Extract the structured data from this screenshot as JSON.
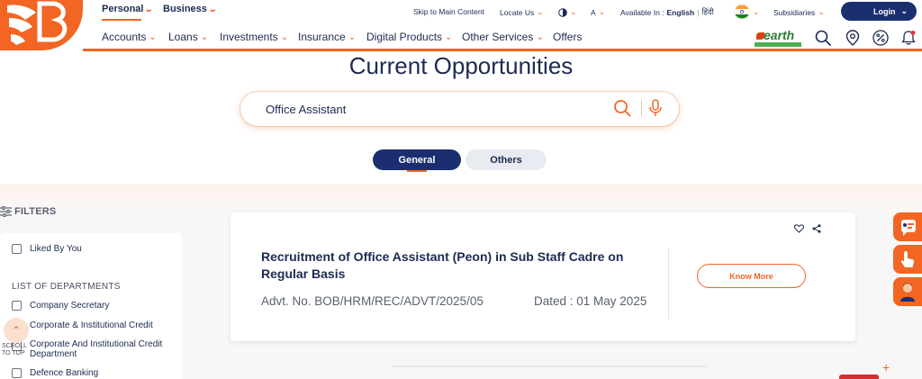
{
  "header": {
    "tabs": [
      {
        "label": "Personal",
        "active": true
      },
      {
        "label": "Business",
        "active": false
      }
    ],
    "top_links": {
      "skip": "Skip to Main Content",
      "locate": "Locate Us",
      "font_size": "A",
      "available_in_label": "Available In :",
      "lang_english": "English",
      "lang_hindi": "हिंदी",
      "subsidiaries": "Subsidiaries",
      "login": "Login"
    },
    "nav": [
      {
        "label": "Accounts",
        "has_menu": true
      },
      {
        "label": "Loans",
        "has_menu": true
      },
      {
        "label": "Investments",
        "has_menu": true
      },
      {
        "label": "Insurance",
        "has_menu": true
      },
      {
        "label": "Digital Products",
        "has_menu": true
      },
      {
        "label": "Other Services",
        "has_menu": true
      },
      {
        "label": "Offers",
        "has_menu": false
      }
    ],
    "earth_logo_text": "earth",
    "icons": [
      "search-icon",
      "location-pin-icon",
      "percent-icon",
      "notification-bell-icon"
    ]
  },
  "main": {
    "title": "Current Opportunities",
    "search": {
      "value": "Office Assistant",
      "placeholder": ""
    },
    "tabs": [
      {
        "label": "General",
        "active": true
      },
      {
        "label": "Others",
        "active": false
      }
    ]
  },
  "filters": {
    "heading": "FILTERS",
    "liked": "Liked By You",
    "departments_heading": "LIST OF DEPARTMENTS",
    "departments": [
      "Company Secretary",
      "Corporate & Institutional Credit",
      "Corporate And Institutional Credit Department",
      "Defence Banking"
    ],
    "scroll_to_top": "SCROLL TO TOP"
  },
  "job": {
    "title": "Recruitment of Office Assistant (Peon) in Sub Staff Cadre on Regular Basis",
    "advt": "Advt. No. BOB/HRM/REC/ADVT/2025/05",
    "date": "Dated : 01 May 2025",
    "know_more": "Know More"
  },
  "colors": {
    "brand_orange": "#f26522",
    "brand_navy": "#1b2e6f",
    "text_navy": "#1d2a52"
  }
}
